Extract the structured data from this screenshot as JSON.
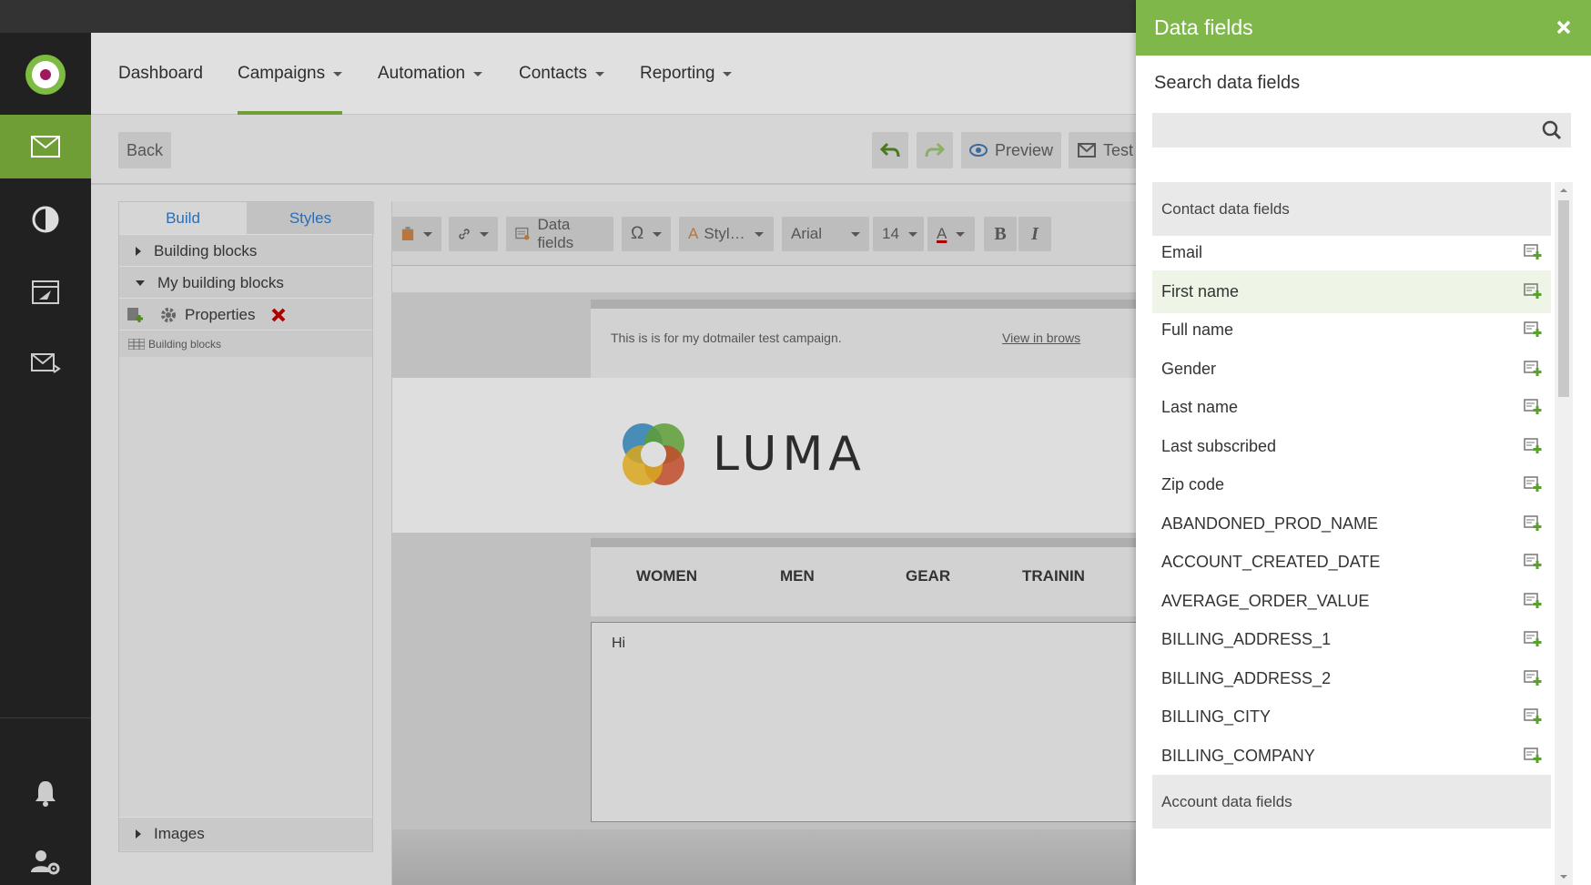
{
  "nav": {
    "menu": [
      {
        "label": "Dashboard",
        "dropdown": false
      },
      {
        "label": "Campaigns",
        "dropdown": true,
        "active": true
      },
      {
        "label": "Automation",
        "dropdown": true
      },
      {
        "label": "Contacts",
        "dropdown": true
      },
      {
        "label": "Reporting",
        "dropdown": true
      }
    ]
  },
  "sidebar_icons": [
    "mail-icon",
    "pie-chart-icon",
    "campaign-send-icon",
    "mail-code-icon",
    "bell-icon",
    "user-settings-icon"
  ],
  "toolbar": {
    "back_label": "Back",
    "preview_label": "Preview",
    "test_label": "Test"
  },
  "left_panel": {
    "tabs": [
      "Build",
      "Styles"
    ],
    "building_blocks": "Building blocks",
    "my_building_blocks": "My building blocks",
    "properties": "Properties",
    "building_blocks_small": "Building blocks",
    "images": "Images"
  },
  "editor_toolbar": {
    "data_fields": "Data fields",
    "styles": "Styl…",
    "font": "Arial",
    "size": "14",
    "bold": "B",
    "italic": "I"
  },
  "email_preview": {
    "preheader_text": "This is is for my dotmailer test campaign.",
    "view_in_browser": "View in brows",
    "brand": "LUMA",
    "nav_items": [
      "WOMEN",
      "MEN",
      "GEAR",
      "TRAININ"
    ],
    "body_text": "Hi"
  },
  "drawer": {
    "title": "Data fields",
    "search_label": "Search data fields",
    "search_value": "",
    "contact_section": "Contact data fields",
    "fields": [
      "Email",
      "First name",
      "Full name",
      "Gender",
      "Last name",
      "Last subscribed",
      "Zip code",
      "ABANDONED_PROD_NAME",
      "ACCOUNT_CREATED_DATE",
      "AVERAGE_ORDER_VALUE",
      "BILLING_ADDRESS_1",
      "BILLING_ADDRESS_2",
      "BILLING_CITY",
      "BILLING_COMPANY"
    ],
    "hovered_field": "First name",
    "account_section": "Account data fields"
  },
  "colors": {
    "brand_green": "#80b74a",
    "nav_dark": "#212121",
    "active_nav": "#6f9e36",
    "delete_red": "#b00000"
  }
}
